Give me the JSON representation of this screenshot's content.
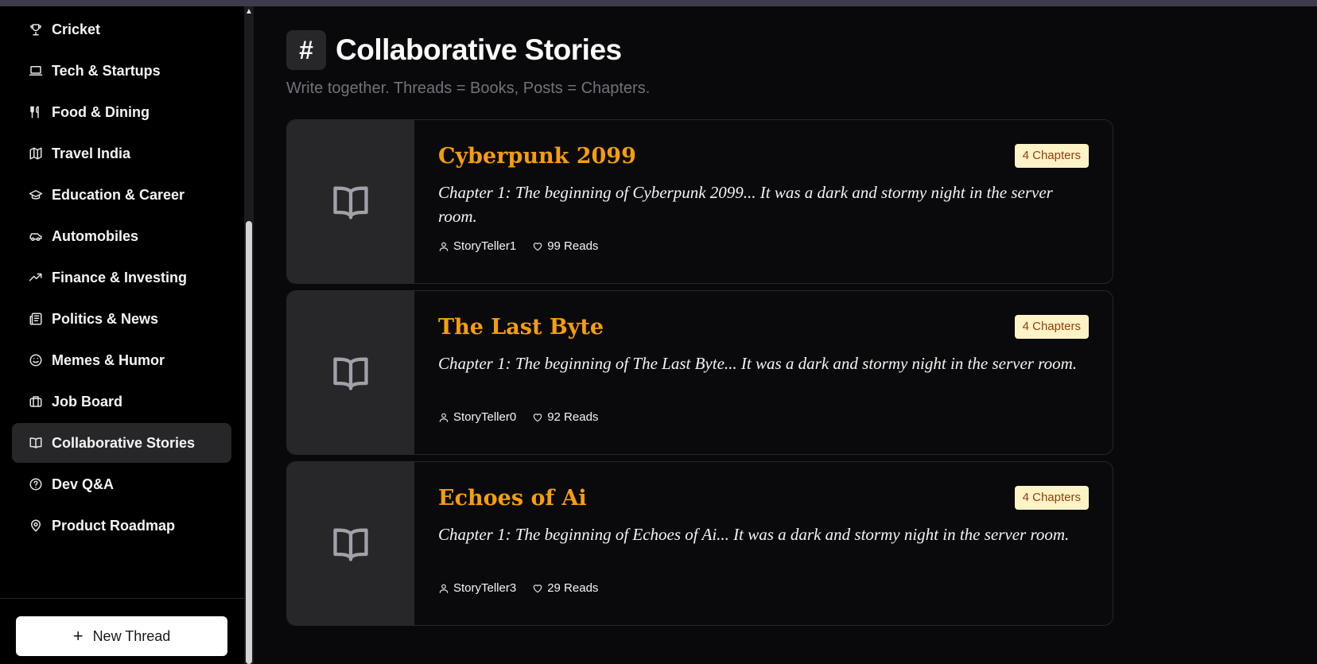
{
  "sidebar": {
    "items": [
      {
        "label": "Cricket",
        "icon": "trophy-icon",
        "active": false
      },
      {
        "label": "Tech & Startups",
        "icon": "laptop-icon",
        "active": false
      },
      {
        "label": "Food & Dining",
        "icon": "utensils-icon",
        "active": false
      },
      {
        "label": "Travel India",
        "icon": "map-icon",
        "active": false
      },
      {
        "label": "Education & Career",
        "icon": "graduation-cap-icon",
        "active": false
      },
      {
        "label": "Automobiles",
        "icon": "car-icon",
        "active": false
      },
      {
        "label": "Finance & Investing",
        "icon": "trending-up-icon",
        "active": false
      },
      {
        "label": "Politics & News",
        "icon": "newspaper-icon",
        "active": false
      },
      {
        "label": "Memes & Humor",
        "icon": "smile-icon",
        "active": false
      },
      {
        "label": "Job Board",
        "icon": "briefcase-icon",
        "active": false
      },
      {
        "label": "Collaborative Stories",
        "icon": "book-open-icon",
        "active": true
      },
      {
        "label": "Dev Q&A",
        "icon": "help-circle-icon",
        "active": false
      },
      {
        "label": "Product Roadmap",
        "icon": "map-pin-icon",
        "active": false
      }
    ],
    "new_thread_label": "New Thread",
    "new_thread_icon": "plus-icon"
  },
  "header": {
    "hash": "#",
    "title": "Collaborative Stories",
    "subtitle": "Write together. Threads = Books, Posts = Chapters."
  },
  "stories": [
    {
      "title": "Cyberpunk 2099",
      "badge": "4 Chapters",
      "excerpt": "Chapter 1: The beginning of Cyberpunk 2099... It was a dark and stormy night in the server room.",
      "author": "StoryTeller1",
      "reads": "99 Reads"
    },
    {
      "title": "The Last Byte",
      "badge": "4 Chapters",
      "excerpt": "Chapter 1: The beginning of The Last Byte... It was a dark and stormy night in the server room.",
      "author": "StoryTeller0",
      "reads": "92 Reads"
    },
    {
      "title": "Echoes of Ai",
      "badge": "4 Chapters",
      "excerpt": "Chapter 1: The beginning of Echoes of Ai... It was a dark and stormy night in the server room.",
      "author": "StoryTeller3",
      "reads": "29 Reads"
    }
  ],
  "colors": {
    "accent": "#f59e0b",
    "badge_bg": "#fef3c7",
    "badge_text": "#92400e",
    "active_bg": "#27272a"
  }
}
